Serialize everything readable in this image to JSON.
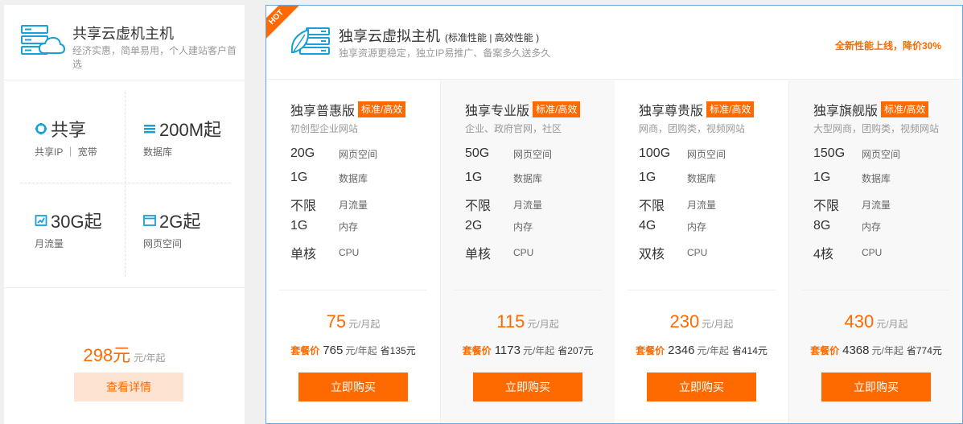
{
  "shared": {
    "title": "共享云虚机主机",
    "desc": "经济实惠，简单易用，个人建站客户首选",
    "features": [
      {
        "value": "共享",
        "label": "共享IP ｜ 宽带",
        "icon": "ip-icon"
      },
      {
        "value": "200M起",
        "label": "数据库",
        "icon": "database-icon"
      },
      {
        "value": "30G起",
        "label": "月流量",
        "icon": "traffic-icon"
      },
      {
        "value": "2G起",
        "label": "网页空间",
        "icon": "web-space-icon"
      }
    ],
    "price": "298元",
    "price_unit": "元/年起",
    "detail_button": "查看详情"
  },
  "exclusive": {
    "hot": "HOT",
    "title": "独享云虚拟主机",
    "subtitle": "(标准性能 | 高效性能 )",
    "desc": "独享资源更稳定，独立IP易推广、备案多久送多久",
    "promo": "全新性能上线，降价30%",
    "plans": [
      {
        "name": "独享普惠版",
        "tag": "标准/高效",
        "target": "初创型企业网站",
        "specs": [
          {
            "value": "20G",
            "label": "网页空间"
          },
          {
            "value": "1G",
            "label": "数据库"
          },
          {
            "value": "不限",
            "label": "月流量"
          },
          {
            "value": "1G",
            "label": "内存"
          },
          {
            "value": "单核",
            "label": "CPU"
          }
        ],
        "price": "75",
        "price_unit": "元/月起",
        "combo_label": "套餐价",
        "combo_price": "765",
        "combo_unit": "元/年起",
        "combo_save": "省135元",
        "buy": "立即购买"
      },
      {
        "name": "独享专业版",
        "tag": "标准/高效",
        "target": "企业、政府官网，社区",
        "specs": [
          {
            "value": "50G",
            "label": "网页空间"
          },
          {
            "value": "1G",
            "label": "数据库"
          },
          {
            "value": "不限",
            "label": "月流量"
          },
          {
            "value": "2G",
            "label": "内存"
          },
          {
            "value": "单核",
            "label": "CPU"
          }
        ],
        "price": "115",
        "price_unit": "元/月起",
        "combo_label": "套餐价",
        "combo_price": "1173",
        "combo_unit": "元/年起",
        "combo_save": "省207元",
        "buy": "立即购买"
      },
      {
        "name": "独享尊贵版",
        "tag": "标准/高效",
        "target": "网商，团购类，视频网站",
        "specs": [
          {
            "value": "100G",
            "label": "网页空间"
          },
          {
            "value": "1G",
            "label": "数据库"
          },
          {
            "value": "不限",
            "label": "月流量"
          },
          {
            "value": "4G",
            "label": "内存"
          },
          {
            "value": "双核",
            "label": "CPU"
          }
        ],
        "price": "230",
        "price_unit": "元/月起",
        "combo_label": "套餐价",
        "combo_price": "2346",
        "combo_unit": "元/年起",
        "combo_save": "省414元",
        "buy": "立即购买"
      },
      {
        "name": "独享旗舰版",
        "tag": "标准/高效",
        "target": "大型网商，团购类，视频网站",
        "specs": [
          {
            "value": "150G",
            "label": "网页空间"
          },
          {
            "value": "1G",
            "label": "数据库"
          },
          {
            "value": "不限",
            "label": "月流量"
          },
          {
            "value": "8G",
            "label": "内存"
          },
          {
            "value": "4核",
            "label": "CPU"
          }
        ],
        "price": "430",
        "price_unit": "元/月起",
        "combo_label": "套餐价",
        "combo_price": "4368",
        "combo_unit": "元/年起",
        "combo_save": "省774元",
        "buy": "立即购买"
      }
    ]
  },
  "colors": {
    "accent": "#ff6a00",
    "icon_blue": "#1aa0d8",
    "border_blue": "#6ca7df",
    "light_accent": "#fde3d1"
  }
}
